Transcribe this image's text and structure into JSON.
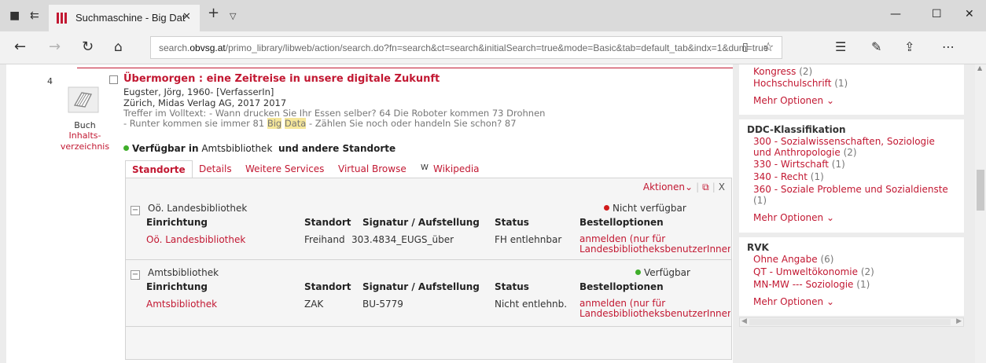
{
  "browser": {
    "tab_title": "Suchmaschine - Big Dat",
    "url_prefix": "search.",
    "url_domain": "obvsg.at",
    "url_rest": "/primo_library/libweb/action/search.do?fn=search&ct=search&initialSearch=true&mode=Basic&tab=default_tab&indx=1&dum=true"
  },
  "record": {
    "number": "4",
    "type": "Buch",
    "toc_link": "Inhalts-verzeichnis",
    "title": "Übermorgen : eine Zeitreise in unsere digitale Zukunft",
    "author": "Eugster, Jörg, 1960- [VerfasserIn]",
    "publisher": "Zürich, Midas Verlag AG, 2017 2017",
    "fulltext_pre": "Treffer im Volltext: - Wann drucken Sie Ihr Essen selber? 64 Die Roboter kommen 73 Drohnen - Runter kommen sie immer 81 ",
    "fulltext_hl1": "Big",
    "fulltext_mid": " ",
    "fulltext_hl2": "Data",
    "fulltext_post": " - Zählen Sie noch oder handeln Sie schon? 87",
    "avail_label": "Verfügbar in",
    "avail_location": "Amtsbibliothek",
    "avail_more": "und andere Standorte"
  },
  "record_tabs": [
    "Standorte",
    "Details",
    "Weitere Services",
    "Virtual Browse",
    "Wikipedia"
  ],
  "panel": {
    "actions": "Aktionen",
    "close": "X",
    "columns": [
      "Einrichtung",
      "Standort",
      "Signatur / Aufstellung",
      "Status",
      "Bestelloptionen"
    ],
    "locations": [
      {
        "name": "Oö. Landesbibliothek",
        "status": "Nicht verfügbar",
        "row": [
          "Oö. Landesbibliothek",
          "Freihand",
          "303.4834_EUGS_über",
          "FH entlehnbar",
          "anmelden (nur für LandesbibliotheksbenutzerInnen)"
        ]
      },
      {
        "name": "Amtsbibliothek",
        "status": "Verfügbar",
        "row": [
          "Amtsbibliothek",
          "ZAK",
          "BU-5779",
          "Nicht entlehnb.",
          "anmelden (nur für LandesbibliotheksbenutzerInnen)"
        ]
      }
    ]
  },
  "facets": {
    "box1": {
      "items": [
        {
          "label": "Kongress",
          "count": "(2)"
        },
        {
          "label": "Hochschulschrift",
          "count": "(1)"
        }
      ],
      "more": "Mehr Optionen"
    },
    "box2": {
      "title": "DDC-Klassifikation",
      "items": [
        {
          "label": "300 - Sozialwissenschaften, Soziologie",
          "label2": "und Anthropologie",
          "count": "(2)"
        },
        {
          "label": "330 - Wirtschaft",
          "count": "(1)"
        },
        {
          "label": "340 - Recht",
          "count": "(1)"
        },
        {
          "label": "360 - Soziale Probleme und Sozialdienste",
          "count": "(1)"
        }
      ],
      "more": "Mehr Optionen"
    },
    "box3": {
      "title": "RVK",
      "items": [
        {
          "label": "Ohne Angabe",
          "count": "(6)"
        },
        {
          "label": "QT - Umweltökonomie",
          "count": "(2)"
        },
        {
          "label": "MN-MW --- Soziologie",
          "count": "(1)"
        }
      ],
      "more": "Mehr Optionen"
    }
  },
  "colors": {
    "accent": "#c21832",
    "available": "#3fae2a",
    "unavailable": "#d11b1b"
  }
}
